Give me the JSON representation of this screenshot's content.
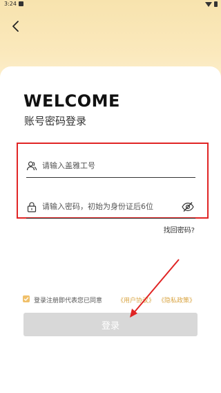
{
  "status_bar": {
    "time": "3:24"
  },
  "header": {
    "back_icon": "chevron-left-icon"
  },
  "hero": {
    "title": "WELCOME",
    "subtitle": "账号密码登录"
  },
  "form": {
    "account": {
      "placeholder": "请输入盖雅工号",
      "value": "",
      "icon": "user-icon"
    },
    "password": {
      "placeholder": "请输入密码，初始为身份证后6位",
      "value": "",
      "icon": "lock-icon",
      "toggle_icon": "eye-off-icon"
    },
    "forgot_label": "找回密码?"
  },
  "agreement": {
    "checked": true,
    "text": "登录注册即代表您已同意",
    "user_agreement": "《用户协议》",
    "privacy_policy": "《隐私政策》"
  },
  "login_button": {
    "label": "登录",
    "enabled": false
  },
  "colors": {
    "accent": "#d9a544",
    "highlight": "#e02424",
    "button_disabled": "#d8d8d8"
  }
}
